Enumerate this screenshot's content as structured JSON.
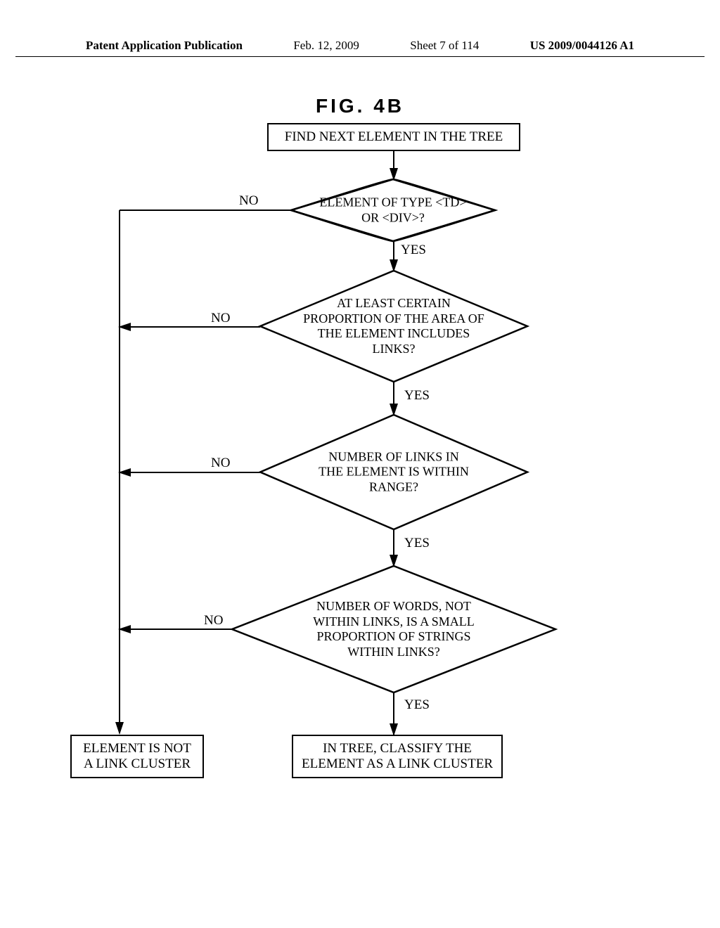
{
  "header": {
    "publication": "Patent Application Publication",
    "date": "Feb. 12, 2009",
    "sheet": "Sheet 7 of 114",
    "pubnum": "US 2009/0044126 A1"
  },
  "figure": {
    "title": "FIG.  4B"
  },
  "boxes": {
    "start": "FIND NEXT ELEMENT IN THE TREE",
    "d1": "ELEMENT OF TYPE <TD> OR <DIV>?",
    "d2": "AT LEAST CERTAIN PROPORTION OF THE AREA OF THE ELEMENT INCLUDES LINKS?",
    "d3": "NUMBER OF LINKS IN THE ELEMENT IS WITHIN RANGE?",
    "d4": "NUMBER OF WORDS, NOT WITHIN LINKS, IS A SMALL PROPORTION OF STRINGS WITHIN LINKS?",
    "end_yes": "IN TREE, CLASSIFY THE ELEMENT AS A LINK CLUSTER",
    "end_no": "ELEMENT IS NOT A LINK CLUSTER"
  },
  "labels": {
    "yes": "YES",
    "no": "NO"
  }
}
